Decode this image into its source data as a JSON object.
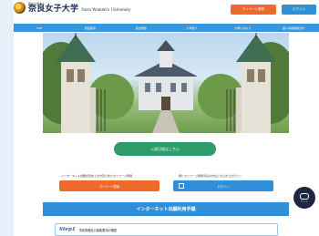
{
  "header": {
    "logo_small": "国立大学法人",
    "logo_main": "奈良女子大学",
    "logo_en": "Nara Women's University",
    "mypage_button": "マイページ登録",
    "login_button": "ログイン"
  },
  "nav": {
    "items": [
      {
        "label": "TOP"
      },
      {
        "label": "募集要項"
      },
      {
        "label": "過去問題"
      },
      {
        "label": "大学紹介"
      },
      {
        "label": "お問い合わせ"
      },
      {
        "label": "個人情報保護方針"
      }
    ]
  },
  "cta": {
    "entry_button": "入試日程はこちら",
    "first_time_label": "インターネット出願が初めての方及びまだマイページ登録",
    "registered_label": "既にマイページ登録済みの方はこちらからログイン",
    "register_button": "マイページ登録",
    "login_button": "ログイン"
  },
  "section": {
    "title": "インターネット出願利用手順",
    "step_label": "Step1",
    "step_text": "事前準備及び募集要項の確認"
  },
  "chat": {
    "label": "チャット"
  },
  "colors": {
    "accent_blue": "#2f8fd8",
    "accent_orange": "#ee6a2a",
    "accent_green": "#2d9b6a",
    "nav_blue": "#3a95d9"
  }
}
